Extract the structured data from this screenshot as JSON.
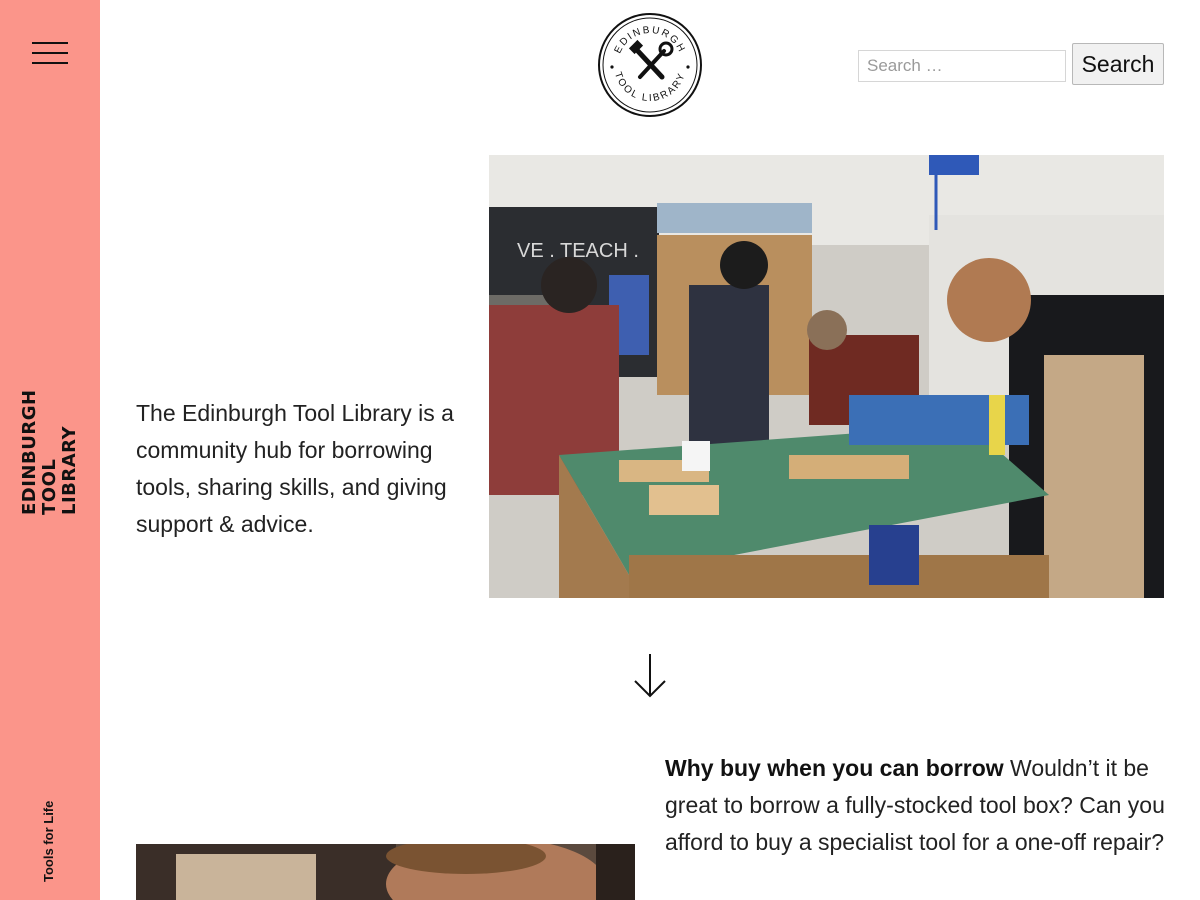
{
  "sidebar": {
    "menu_icon": "hamburger-menu-icon",
    "brand_lines": [
      "EDINBURGH",
      "TOOL",
      "LIBRARY"
    ],
    "tagline": "Tools for Life",
    "background_color": "#fb958a"
  },
  "header": {
    "logo": {
      "top_text": "EDINBURGH",
      "bottom_text": "TOOL LIBRARY",
      "icon": "hammer-and-wrench-icon"
    },
    "search": {
      "placeholder": "Search …",
      "value": "",
      "button_label": "Search"
    }
  },
  "hero": {
    "intro_text": "The Edinburgh Tool Library is a community hub for borrowing tools, sharing skills, and giving support & advice.",
    "photo": "workshop-photo",
    "wall_sign_text": "VE . TEACH ."
  },
  "scroll_icon": "arrow-down-icon",
  "borrow": {
    "heading": "Why buy when you can borrow",
    "body": " Wouldn’t it be great to borrow a fully-stocked tool box? Can you afford to buy a specialist tool for a one-off repair?",
    "photo": "person-photo"
  }
}
